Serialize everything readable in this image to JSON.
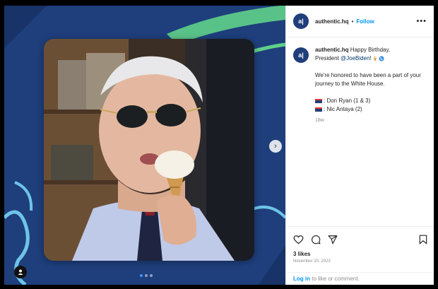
{
  "post": {
    "username": "authentic.hq",
    "separator": "•",
    "follow_label": "Follow",
    "more_icon": "more-icon",
    "avatar_text": "a|"
  },
  "caption": {
    "username": "authentic.hq",
    "line1": "Happy Birthday,",
    "line2_prefix": "President",
    "mention": "@JoeBiden!",
    "para2": "We're honored to have been a part of your journey to the White House.",
    "credit1": ": Don Ryan (1 & 3)",
    "credit2": ": Nic Antaya (2)",
    "time": "18w"
  },
  "media": {
    "carousel_count": 3,
    "carousel_active": 0,
    "next_icon": "chevron-right-icon",
    "tag_icon": "user-tag-icon",
    "photo_alt": "Man in aviator sunglasses eating an ice cream cone"
  },
  "engagement": {
    "likes": "3 likes",
    "date": "November 20, 2023"
  },
  "footer": {
    "login_link": "Log in",
    "login_rest": " to like or comment."
  },
  "colors": {
    "brand_blue": "#1f3e7a",
    "link": "#0095f6",
    "accent_green": "#5fd08a"
  }
}
